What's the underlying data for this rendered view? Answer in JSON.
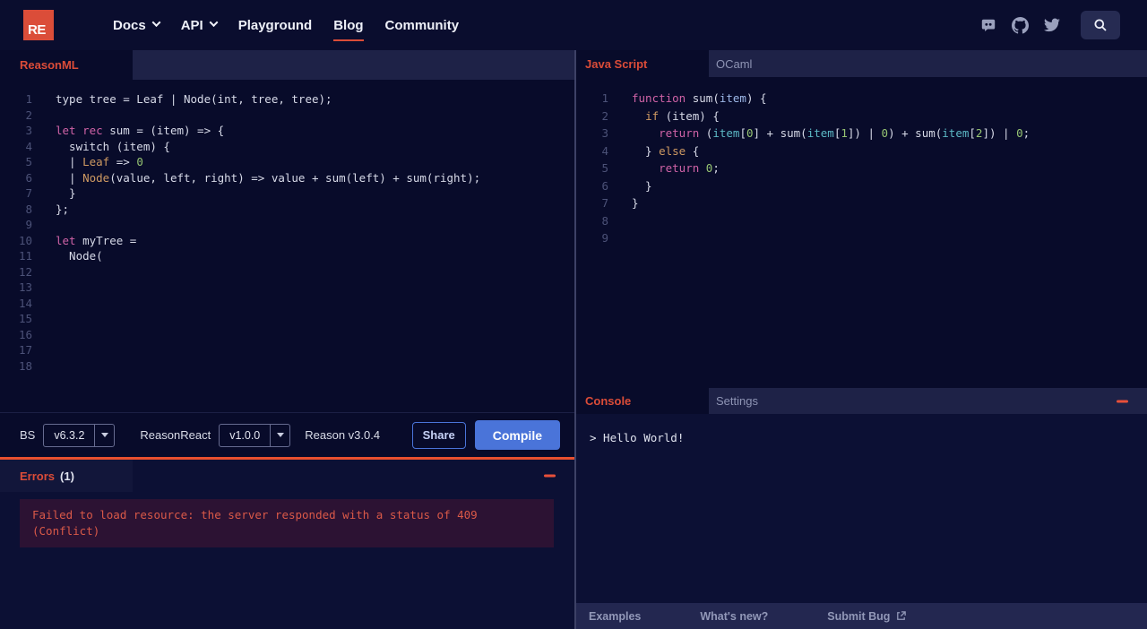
{
  "colors": {
    "accent_red": "#db4c38",
    "logo_red": "#db4d39",
    "error_border_orange": "#e8502f",
    "error_text": "#da5948",
    "button_blue": "#4a74d9"
  },
  "nav": {
    "logo_text": "RE",
    "items": [
      {
        "label": "Docs",
        "chevron": true,
        "active": false
      },
      {
        "label": "API",
        "chevron": true,
        "active": false
      },
      {
        "label": "Playground",
        "chevron": false,
        "active": false
      },
      {
        "label": "Blog",
        "chevron": false,
        "active": true
      },
      {
        "label": "Community",
        "chevron": false,
        "active": false
      }
    ],
    "icons": [
      "discord-icon",
      "github-icon",
      "twitter-icon",
      "search-icon"
    ]
  },
  "left_pane": {
    "tab_label": "ReasonML",
    "code": [
      {
        "n": 1,
        "s": [
          [
            "p",
            "type tree = Leaf | Node(int, tree, tree);"
          ]
        ]
      },
      {
        "n": 2,
        "s": []
      },
      {
        "n": 3,
        "s": [
          [
            "k",
            "let rec"
          ],
          [
            "p",
            " sum = (item) => {"
          ]
        ]
      },
      {
        "n": 4,
        "s": [
          [
            "p",
            "  switch (item) {"
          ]
        ]
      },
      {
        "n": 5,
        "s": [
          [
            "p",
            "  | "
          ],
          [
            "o",
            "Leaf"
          ],
          [
            "p",
            " => "
          ],
          [
            "g",
            "0"
          ]
        ]
      },
      {
        "n": 6,
        "s": [
          [
            "p",
            "  | "
          ],
          [
            "o",
            "Node"
          ],
          [
            "p",
            "(value, left, right) => value + sum(left) + sum(right);"
          ]
        ]
      },
      {
        "n": 7,
        "s": [
          [
            "p",
            "  }"
          ]
        ]
      },
      {
        "n": 8,
        "s": [
          [
            "p",
            "};"
          ]
        ]
      },
      {
        "n": 9,
        "s": []
      },
      {
        "n": 10,
        "s": [
          [
            "k",
            "let"
          ],
          [
            "p",
            " myTree ="
          ]
        ]
      },
      {
        "n": 11,
        "s": [
          [
            "p",
            "  Node("
          ]
        ]
      },
      {
        "n": 12,
        "s": []
      },
      {
        "n": 13,
        "s": []
      },
      {
        "n": 14,
        "s": []
      },
      {
        "n": 15,
        "s": []
      },
      {
        "n": 16,
        "s": []
      },
      {
        "n": 17,
        "s": []
      },
      {
        "n": 18,
        "s": []
      }
    ],
    "toolbar": {
      "bs_label": "BS",
      "bs_version": "v6.3.2",
      "reasonreact_label": "ReasonReact",
      "reasonreact_version": "v1.0.0",
      "reason_version": "Reason v3.0.4",
      "share_label": "Share",
      "compile_label": "Compile"
    },
    "errors": {
      "title": "Errors",
      "count": "(1)",
      "message": "Failed to load resource: the server responded with a status of 409 (Conflict)"
    }
  },
  "right_pane": {
    "tabs": [
      {
        "label": "Java Script",
        "active": true
      },
      {
        "label": "OCaml",
        "active": false
      }
    ],
    "code": [
      {
        "n": 1,
        "s": [
          [
            "k",
            "function"
          ],
          [
            "p",
            " sum("
          ],
          [
            "b",
            "item"
          ],
          [
            "p",
            ") {"
          ]
        ]
      },
      {
        "n": 2,
        "s": [
          [
            "p",
            "  "
          ],
          [
            "o",
            "if"
          ],
          [
            "p",
            " (item) {"
          ]
        ]
      },
      {
        "n": 3,
        "s": [
          [
            "p",
            "    "
          ],
          [
            "k",
            "return"
          ],
          [
            "p",
            " ("
          ],
          [
            "t",
            "item"
          ],
          [
            "p",
            "["
          ],
          [
            "g",
            "0"
          ],
          [
            "p",
            "] + sum("
          ],
          [
            "t",
            "item"
          ],
          [
            "p",
            "["
          ],
          [
            "g",
            "1"
          ],
          [
            "p",
            "]) | "
          ],
          [
            "g",
            "0"
          ],
          [
            "p",
            ") + sum("
          ],
          [
            "t",
            "item"
          ],
          [
            "p",
            "["
          ],
          [
            "g",
            "2"
          ],
          [
            "p",
            "]) | "
          ],
          [
            "g",
            "0"
          ],
          [
            "p",
            ";"
          ]
        ]
      },
      {
        "n": 4,
        "s": [
          [
            "p",
            "  } "
          ],
          [
            "o",
            "else"
          ],
          [
            "p",
            " {"
          ]
        ]
      },
      {
        "n": 5,
        "s": [
          [
            "p",
            "    "
          ],
          [
            "k",
            "return"
          ],
          [
            "p",
            " "
          ],
          [
            "g",
            "0"
          ],
          [
            "p",
            ";"
          ]
        ]
      },
      {
        "n": 6,
        "s": [
          [
            "p",
            "  }"
          ]
        ]
      },
      {
        "n": 7,
        "s": [
          [
            "p",
            "}"
          ]
        ]
      },
      {
        "n": 8,
        "s": []
      },
      {
        "n": 9,
        "s": []
      }
    ],
    "console": {
      "tabs": [
        {
          "label": "Console",
          "active": true
        },
        {
          "label": "Settings",
          "active": false
        }
      ],
      "output": "> Hello World!"
    },
    "footer_links": [
      "Examples",
      "What's new?",
      "Submit Bug"
    ]
  }
}
